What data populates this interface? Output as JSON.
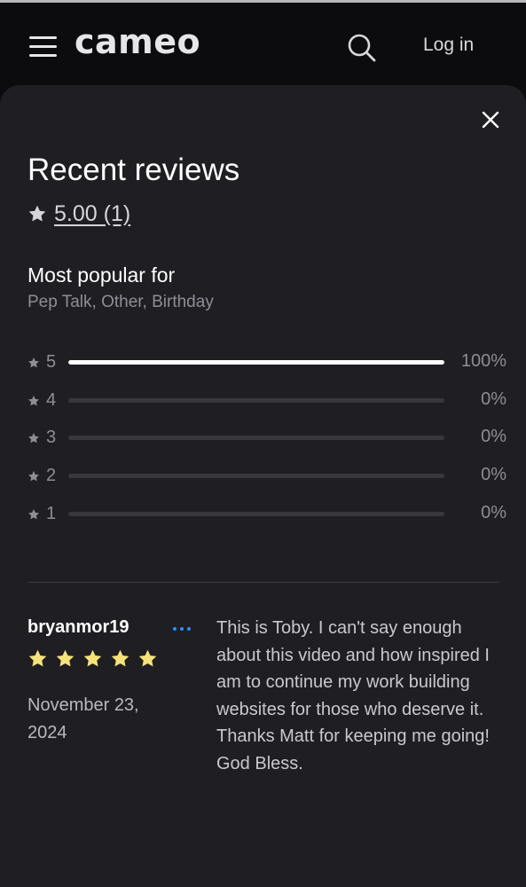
{
  "header": {
    "logo": "cameo",
    "login_label": "Log in"
  },
  "icons": {
    "menu": "hamburger-menu-icon",
    "search": "search-icon",
    "close": "close-icon",
    "star": "star-icon",
    "more": "more-options-icon"
  },
  "colors": {
    "background": "#0c0c0e",
    "sheet": "#1f1e23",
    "muted_text": "#8e8e96",
    "star_yellow": "#f7e27a",
    "more_blue": "#2f8cff",
    "bar_track": "#38373d",
    "bar_fill": "#ffffff"
  },
  "reviews": {
    "title": "Recent reviews",
    "overall_rating": "5.00 (1)",
    "most_popular_label": "Most popular for",
    "most_popular_value": "Pep Talk, Other, Birthday",
    "breakdown": [
      {
        "stars": "5",
        "percent_label": "100%",
        "fraction": 1.0
      },
      {
        "stars": "4",
        "percent_label": "0%",
        "fraction": 0
      },
      {
        "stars": "3",
        "percent_label": "0%",
        "fraction": 0
      },
      {
        "stars": "2",
        "percent_label": "0%",
        "fraction": 0
      },
      {
        "stars": "1",
        "percent_label": "0%",
        "fraction": 0
      }
    ],
    "items": [
      {
        "reviewer": "bryanmor19",
        "rating": 5,
        "date": "November 23, 2024",
        "text": "This is Toby. I can't say enough about this video and how inspired I am to continue my work building websites for those who deserve it. Thanks Matt for keeping me going! God Bless."
      }
    ]
  }
}
